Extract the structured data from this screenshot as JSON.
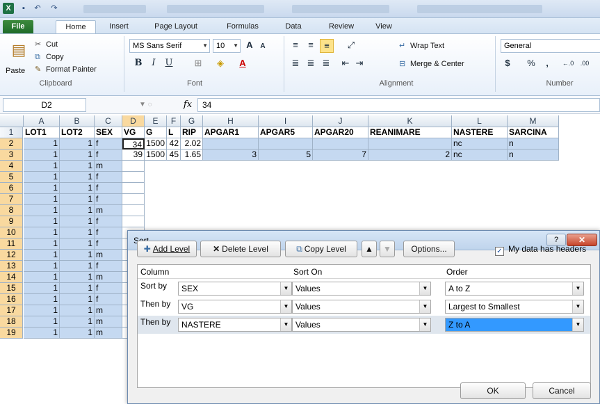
{
  "titlebar": {
    "app_icon": "X",
    "undo": "↶",
    "redo": "↷"
  },
  "tabs": [
    "File",
    "Home",
    "Insert",
    "Page Layout",
    "Formulas",
    "Data",
    "Review",
    "View"
  ],
  "ribbon": {
    "paste": "Paste",
    "cut": "Cut",
    "copy": "Copy",
    "format_painter": "Format Painter",
    "font_name": "MS Sans Serif",
    "font_size": "10",
    "bold": "B",
    "italic": "I",
    "underline": "U",
    "wrap_text": "Wrap Text",
    "merge_center": "Merge & Center",
    "number_format": "General",
    "currency": "$",
    "percent": "%",
    "comma": ",",
    "groups": {
      "clipboard": "Clipboard",
      "font": "Font",
      "alignment": "Alignment",
      "number": "Number"
    }
  },
  "formula_bar": {
    "name_box": "D2",
    "fx": "fx",
    "value": "34"
  },
  "grid": {
    "columns": [
      "A",
      "B",
      "C",
      "D",
      "E",
      "F",
      "G",
      "H",
      "I",
      "J",
      "K",
      "L",
      "M"
    ],
    "header_row": [
      "LOT1",
      "LOT2",
      "SEX",
      "VG",
      "G",
      "L",
      "RIP",
      "APGAR1",
      "APGAR5",
      "APGAR20",
      "REANIMARE",
      "NASTERE",
      "SARCINA"
    ],
    "row2": [
      "1",
      "1",
      "f",
      "34",
      "1500",
      "42",
      "2.02",
      "",
      "",
      "",
      "",
      "nc",
      "n"
    ],
    "row3": [
      "1",
      "1",
      "f",
      "39",
      "1500",
      "45",
      "1.65",
      "3",
      "5",
      "7",
      "2",
      "nc",
      "n"
    ],
    "rows_ac": [
      [
        "1",
        "1",
        "m"
      ],
      [
        "1",
        "1",
        "f"
      ],
      [
        "1",
        "1",
        "f"
      ],
      [
        "1",
        "1",
        "f"
      ],
      [
        "1",
        "1",
        "m"
      ],
      [
        "1",
        "1",
        "f"
      ],
      [
        "1",
        "1",
        "f"
      ],
      [
        "1",
        "1",
        "f"
      ],
      [
        "1",
        "1",
        "m"
      ],
      [
        "1",
        "1",
        "f"
      ],
      [
        "1",
        "1",
        "m"
      ],
      [
        "1",
        "1",
        "f"
      ],
      [
        "1",
        "1",
        "f"
      ],
      [
        "1",
        "1",
        "m"
      ],
      [
        "1",
        "1",
        "m"
      ],
      [
        "1",
        "1",
        "m"
      ]
    ],
    "row_numbers": [
      "1",
      "2",
      "3",
      "4",
      "5",
      "6",
      "7",
      "8",
      "9",
      "10",
      "11",
      "12",
      "13",
      "14",
      "15",
      "16",
      "17",
      "18",
      "19"
    ]
  },
  "dialog": {
    "title": "Sort",
    "help": "?",
    "close": "✕",
    "add_level": "Add Level",
    "delete_level": "Delete Level",
    "copy_level": "Copy Level",
    "options": "Options...",
    "headers_checkbox": "My data has headers",
    "headers_checked": true,
    "col_header": "Column",
    "sorton_header": "Sort On",
    "order_header": "Order",
    "levels": [
      {
        "label": "Sort by",
        "column": "SEX",
        "sort_on": "Values",
        "order": "A to Z"
      },
      {
        "label": "Then by",
        "column": "VG",
        "sort_on": "Values",
        "order": "Largest to Smallest"
      },
      {
        "label": "Then by",
        "column": "NASTERE",
        "sort_on": "Values",
        "order": "Z to A"
      }
    ],
    "ok": "OK",
    "cancel": "Cancel"
  },
  "colors": {
    "selection_blue": "#c5d9f1",
    "focus_blue": "#3399ff",
    "excel_green": "#1e7145"
  }
}
